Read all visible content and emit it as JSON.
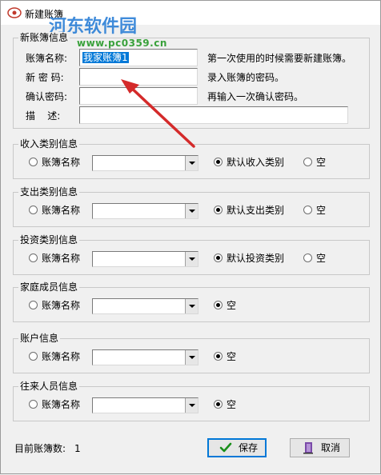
{
  "window": {
    "title": "新建账簿"
  },
  "watermark": {
    "brand": "河东软件园",
    "url": "www.pc0359.cn"
  },
  "book_info": {
    "group_title": "新账簿信息",
    "name_label": "账簿名称:",
    "name_value": "我家账簿1",
    "name_hint": "第一次使用的时候需要新建账簿。",
    "password_label": "新 密 码:",
    "password_hint": "录入账簿的密码。",
    "confirm_label": "确认密码:",
    "confirm_hint": "再输入一次确认密码。",
    "desc_label": "描    述:"
  },
  "groups": {
    "income": {
      "title": "收入类别信息",
      "radio1": "账簿名称",
      "radio2": "默认收入类别",
      "radio3": "空"
    },
    "expense": {
      "title": "支出类别信息",
      "radio1": "账簿名称",
      "radio2": "默认支出类别",
      "radio3": "空"
    },
    "invest": {
      "title": "投资类别信息",
      "radio1": "账簿名称",
      "radio2": "默认投资类别",
      "radio3": "空"
    },
    "family": {
      "title": "家庭成员信息",
      "radio1": "账簿名称",
      "radio2": "空"
    },
    "account": {
      "title": "账户信息",
      "radio1": "账簿名称",
      "radio2": "空"
    },
    "contacts": {
      "title": "往来人员信息",
      "radio1": "账簿名称",
      "radio2": "空"
    }
  },
  "footer": {
    "count_label": "目前账簿数:",
    "count_value": "1",
    "save_label": "保存",
    "cancel_label": "取消"
  },
  "colors": {
    "selection": "#0078d7",
    "arrow": "#d42a2a",
    "watermark_blue": "#2b7fd6",
    "watermark_green": "#39a13b"
  }
}
